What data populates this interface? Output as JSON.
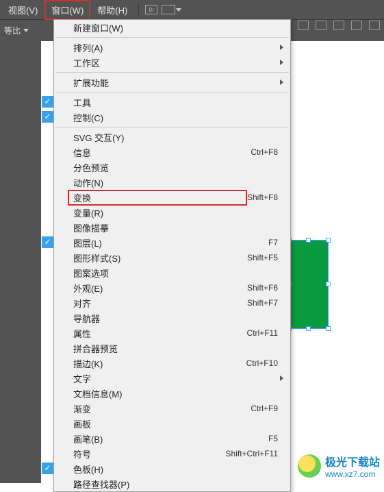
{
  "menubar": {
    "view": "视图(V)",
    "window": "窗口(W)",
    "help": "帮助(H)",
    "br_icon": "Br"
  },
  "toolbar2": {
    "ratio_label": "等比",
    "caret": "▾"
  },
  "dropdown": {
    "new_window": "新建窗口(W)",
    "arrange": "排列(A)",
    "workspace": "工作区",
    "extensions": "扩展功能",
    "tools": "工具",
    "control": "控制(C)",
    "svg": "SVG 交互(Y)",
    "info": {
      "label": "信息",
      "sc": "Ctrl+F8"
    },
    "separations": "分色预览",
    "actions": "动作(N)",
    "transform": {
      "label": "变换",
      "sc": "Shift+F8"
    },
    "variables": "变量(R)",
    "image_trace": "图像描摹",
    "layers": {
      "label": "图层(L)",
      "sc": "F7"
    },
    "graphic_styles": {
      "label": "图形样式(S)",
      "sc": "Shift+F5"
    },
    "pattern_options": "图案选项",
    "appearance": {
      "label": "外观(E)",
      "sc": "Shift+F6"
    },
    "align": {
      "label": "对齐",
      "sc": "Shift+F7"
    },
    "navigator": "导航器",
    "attributes": {
      "label": "属性",
      "sc": "Ctrl+F11"
    },
    "flattener": "拼合器预览",
    "stroke": {
      "label": "描边(K)",
      "sc": "Ctrl+F10"
    },
    "text": "文字",
    "doc_info": "文档信息(M)",
    "gradient": {
      "label": "渐变",
      "sc": "Ctrl+F9"
    },
    "artboards": "画板",
    "brushes": {
      "label": "画笔(B)",
      "sc": "F5"
    },
    "symbols": {
      "label": "符号",
      "sc": "Shift+Ctrl+F11"
    },
    "swatches": "色板(H)",
    "last": "路径查找器(P)"
  },
  "watermark": {
    "title": "极光下载站",
    "url": "www.xz7.com"
  }
}
